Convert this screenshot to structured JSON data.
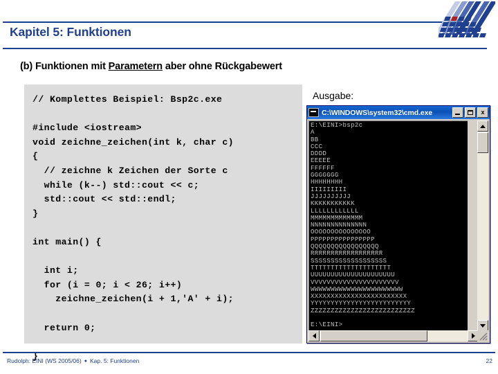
{
  "slide": {
    "title": "Kapitel 5: Funktionen",
    "subtitle_pre": "(b) Funktionen mit ",
    "subtitle_underlined": "Parametern",
    "subtitle_post": " aber ohne Rückgabewert",
    "accent_color": "#1f3f8f",
    "logo_name": "university-logo"
  },
  "code": {
    "language": "cpp",
    "text": "// Komplettes Beispiel: Bsp2c.exe\n\n#include <iostream>\nvoid zeichne_zeichen(int k, char c)\n{\n  // zeichne k Zeichen der Sorte c\n  while (k--) std::cout << c;\n  std::cout << std::endl;\n}\n\nint main() {\n\n  int i;\n  for (i = 0; i < 26; i++)\n    zeichne_zeichen(i + 1,'A' + i);\n\n  return 0;\n\n}",
    "background_color": "#dcdcdc"
  },
  "output": {
    "label": "Ausgabe:",
    "console": {
      "title": "C:\\WINDOWS\\system32\\cmd.exe",
      "icon": "console-icon",
      "minimize_label": "",
      "maximize_label": "",
      "close_label": "x",
      "prompt_command": "E:\\EINI>bsp2c",
      "prompt_end": "E:\\EINI>",
      "text": "E:\\EINI>bsp2c\nA\nBB\nCCC\nDDDD\nEEEEE\nFFFFFF\nGGGGGGG\nHHHHHHHH\nIIIIIIIII\nJJJJJJJJJJ\nKKKKKKKKKKK\nLLLLLLLLLLLL\nMMMMMMMMMMMMM\nNNNNNNNNNNNNNN\nOOOOOOOOOOOOOOO\nPPPPPPPPPPPPPPPP\nQQQQQQQQQQQQQQQQQ\nRRRRRRRRRRRRRRRRRR\nSSSSSSSSSSSSSSSSSSS\nTTTTTTTTTTTTTTTTTTTT\nUUUUUUUUUUUUUUUUUUUUU\nVVVVVVVVVVVVVVVVVVVVVV\nWWWWWWWWWWWWWWWWWWWWWWW\nXXXXXXXXXXXXXXXXXXXXXXXX\nYYYYYYYYYYYYYYYYYYYYYYYYY\nZZZZZZZZZZZZZZZZZZZZZZZZZZ\n\nE:\\EINI>",
      "background_color": "#000000",
      "text_color": "#c0c0c0",
      "titlebar_color": "#0a50b4"
    }
  },
  "footer": {
    "author_course": "Rudolph: EINI (WS 2005/06)",
    "bullet": "●",
    "chapter": "Kap. 5: Funktionen",
    "page_number": "22"
  }
}
